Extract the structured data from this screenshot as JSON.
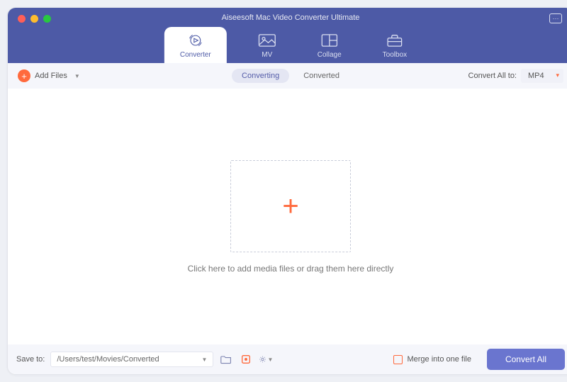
{
  "app_title": "Aiseesoft Mac Video Converter Ultimate",
  "tabs": {
    "converter": "Converter",
    "mv": "MV",
    "collage": "Collage",
    "toolbox": "Toolbox"
  },
  "toolbar": {
    "add_files": "Add Files",
    "converting": "Converting",
    "converted": "Converted",
    "convert_all_to_label": "Convert All to:",
    "format_selected": "MP4"
  },
  "body": {
    "hint": "Click here to add media files or drag them here directly"
  },
  "footer": {
    "save_to_label": "Save to:",
    "save_path": "/Users/test/Movies/Converted",
    "merge_label": "Merge into one file",
    "convert_all_btn": "Convert All"
  }
}
